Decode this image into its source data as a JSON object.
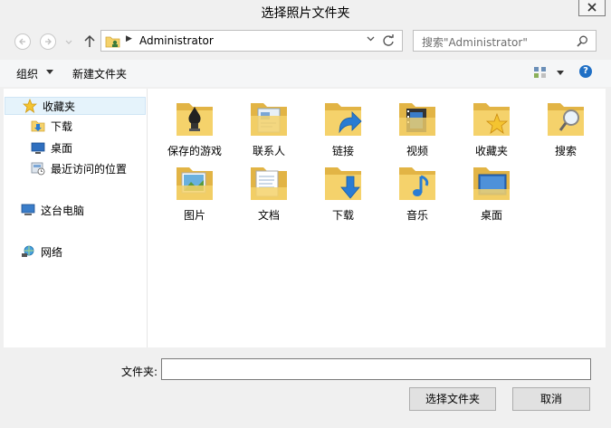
{
  "window": {
    "title": "选择照片文件夹"
  },
  "address": {
    "path": "Administrator"
  },
  "search": {
    "placeholder": "搜索\"Administrator\""
  },
  "toolbar": {
    "organize_label": "组织",
    "new_folder_label": "新建文件夹"
  },
  "nav": {
    "items": [
      {
        "label": "收藏夹",
        "icon": "star-icon"
      },
      {
        "label": "下载",
        "icon": "download-folder-icon"
      },
      {
        "label": "桌面",
        "icon": "desktop-icon"
      },
      {
        "label": "最近访问的位置",
        "icon": "recent-places-icon"
      },
      {
        "label": "这台电脑",
        "icon": "computer-icon"
      },
      {
        "label": "网络",
        "icon": "network-icon"
      }
    ]
  },
  "folders": [
    {
      "label": "保存的游戏",
      "icon": "saved-games-icon"
    },
    {
      "label": "联系人",
      "icon": "contacts-icon"
    },
    {
      "label": "链接",
      "icon": "links-icon"
    },
    {
      "label": "视频",
      "icon": "videos-icon"
    },
    {
      "label": "收藏夹",
      "icon": "favorites-icon"
    },
    {
      "label": "搜索",
      "icon": "searches-icon"
    },
    {
      "label": "图片",
      "icon": "pictures-icon"
    },
    {
      "label": "文档",
      "icon": "documents-icon"
    },
    {
      "label": "下载",
      "icon": "downloads-icon"
    },
    {
      "label": "音乐",
      "icon": "music-icon"
    },
    {
      "label": "桌面",
      "icon": "desktop-folder-icon"
    }
  ],
  "footer": {
    "folder_label": "文件夹:",
    "folder_value": "",
    "select_button": "选择文件夹",
    "cancel_button": "取消"
  },
  "colors": {
    "folder": "#f5d26b",
    "folder_dark": "#e2b445",
    "selection": "#e5f3fb",
    "accent": "#1f6fc5"
  }
}
